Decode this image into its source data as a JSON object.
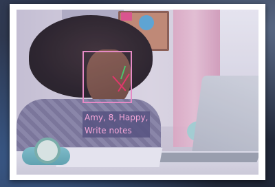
{
  "overlay": {
    "label_line1": "Amy, 8, Happy,",
    "label_line2": "Write notes",
    "box_color": "#e58ac5",
    "label_text_color": "#f4a6d8",
    "pose_colors": [
      "#e0376b",
      "#4cc46d"
    ]
  }
}
